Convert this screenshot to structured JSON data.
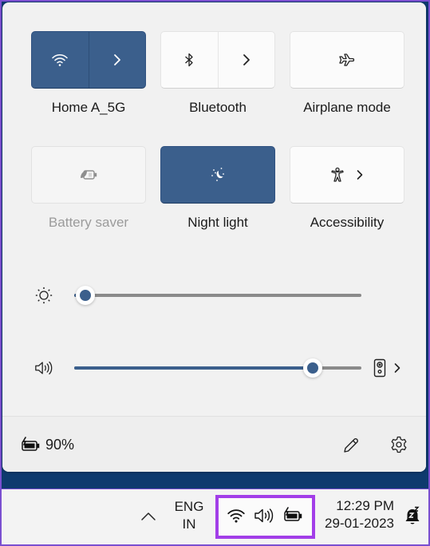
{
  "quick_settings": {
    "tiles": [
      {
        "id": "wifi",
        "label": "Home A_5G",
        "icon": "wifi-icon",
        "state": "on",
        "has_expand": true
      },
      {
        "id": "bluetooth",
        "label": "Bluetooth",
        "icon": "bluetooth-icon",
        "state": "off",
        "has_expand": true
      },
      {
        "id": "airplane",
        "label": "Airplane mode",
        "icon": "airplane-icon",
        "state": "off",
        "has_expand": false
      },
      {
        "id": "battery-saver",
        "label": "Battery saver",
        "icon": "battery-saver-icon",
        "state": "disabled",
        "has_expand": false
      },
      {
        "id": "night-light",
        "label": "Night light",
        "icon": "night-light-icon",
        "state": "on",
        "has_expand": false
      },
      {
        "id": "accessibility",
        "label": "Accessibility",
        "icon": "accessibility-icon",
        "state": "off",
        "has_expand": true
      }
    ],
    "brightness": {
      "icon": "brightness-icon",
      "value_percent": 4
    },
    "volume": {
      "icon": "speaker-icon",
      "value_percent": 83,
      "output_device_icon": "speaker-device-icon"
    },
    "footer": {
      "battery_icon": "battery-charging-icon",
      "battery_percent": "90%",
      "edit_icon": "pencil-icon",
      "settings_icon": "gear-icon"
    }
  },
  "taskbar": {
    "overflow_icon": "chevron-up-icon",
    "language_line1": "ENG",
    "language_line2": "IN",
    "tray_icons": [
      "wifi-icon",
      "speaker-icon",
      "battery-charging-icon"
    ],
    "time": "12:29 PM",
    "date": "29-01-2023",
    "notification_icon": "bell-snooze-icon"
  },
  "colors": {
    "accent": "#3b5f8c",
    "highlight_border": "#a23ee8",
    "flyout_bg": "#f1f1f1",
    "desktop_bg": "#0e3a6e"
  }
}
